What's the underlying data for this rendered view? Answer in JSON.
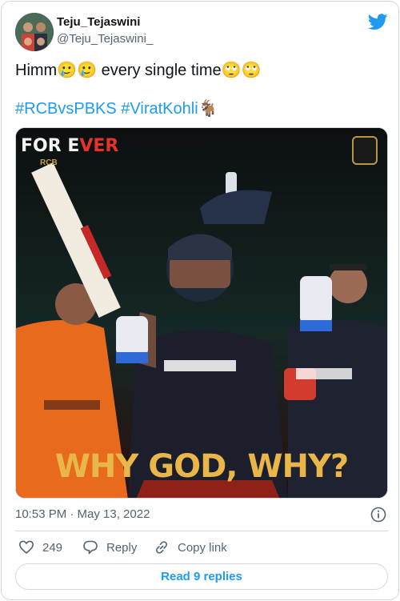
{
  "author": {
    "display_name": "Teju_Tejaswini",
    "handle": "@Teju_Tejaswini_"
  },
  "tweet": {
    "text": "Himm🥲🥲 every single time🙄🙄",
    "hashtags": [
      "#RCBvsPBKS",
      "#ViratKohli🐐"
    ]
  },
  "media": {
    "logo_main": "FOR E",
    "logo_accent": "VER",
    "logo_sub": "RCB",
    "caption": "WHY GOD, WHY?"
  },
  "meta": {
    "timestamp": "10:53 PM · May 13, 2022"
  },
  "actions": {
    "like_count": "249",
    "reply_label": "Reply",
    "copy_label": "Copy link"
  },
  "footer": {
    "replies_label": "Read 9 replies"
  },
  "colors": {
    "accent": "#1d9bf0",
    "secondary_text": "#536471",
    "border": "#cfd9de"
  },
  "icons": [
    "twitter-bird-icon",
    "info-icon",
    "heart-icon",
    "reply-icon",
    "link-icon"
  ]
}
